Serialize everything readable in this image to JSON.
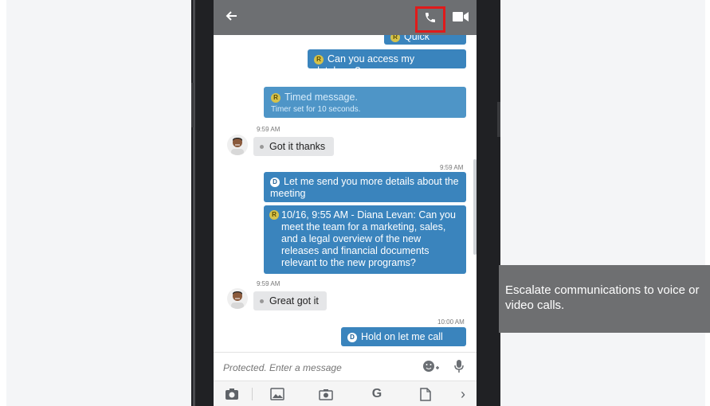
{
  "app": {
    "back_icon": "arrow-left-icon",
    "call_icon": "phone-icon",
    "video_icon": "video-camera-icon"
  },
  "messages": [
    {
      "label": "Quick request"
    },
    {
      "label": "Can you access my database?"
    },
    {
      "title": "Timed message.",
      "subtitle": "Timer set for 10 seconds."
    },
    {
      "time": "9:59 AM",
      "label": "Got it thanks"
    },
    {
      "time": "9:59 AM",
      "label": "Let me send you more details about the meeting"
    },
    {
      "label": "10/16, 9:55 AM - Diana Levan: Can you meet the team for a marketing, sales, and a legal overview of the new releases and financial documents relevant to the new programs?"
    },
    {
      "time": "9:59 AM",
      "label": "Great got it"
    },
    {
      "time": "10:00 AM",
      "label": "Hold on let me call you"
    }
  ],
  "badges": {
    "r": "R",
    "d": "D"
  },
  "composer": {
    "placeholder": "Protected. Enter a message"
  },
  "toolbar_icons": [
    "camera-plus-icon",
    "image-icon",
    "camera-icon",
    "google-g-icon",
    "document-icon",
    "chevron-right-icon"
  ],
  "toolbar_glyphs": {
    "google": "G",
    "more": "›"
  },
  "caption": "Escalate communications to voice or video calls.",
  "colors": {
    "outgoing": "#3a84bd",
    "incoming": "#e5e6e8",
    "appbar": "#6d6f72",
    "highlight": "#e01b1b"
  }
}
